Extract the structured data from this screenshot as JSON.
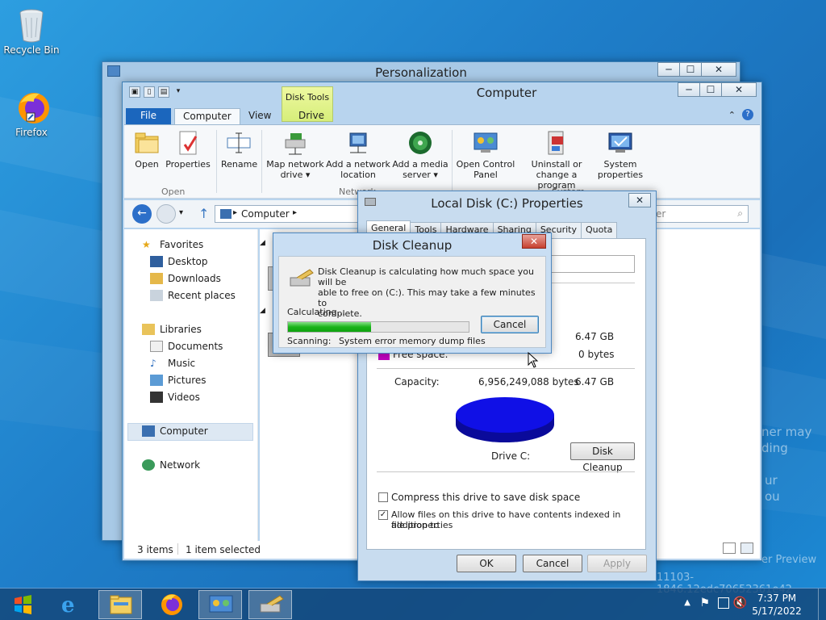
{
  "desktop": {
    "icons": [
      {
        "label": "Recycle Bin",
        "icon": "recycle-bin-icon"
      },
      {
        "label": "Firefox",
        "icon": "firefox-icon"
      }
    ],
    "watermark_lines": [
      "ner may",
      "ding",
      "ur",
      "ou",
      "er Preview",
      "11103-1846.12edc70652361e42"
    ]
  },
  "personalization": {
    "title": "Personalization",
    "caption": {
      "minimize": "─",
      "maximize": "☐",
      "close": "✕"
    }
  },
  "computer": {
    "title": "Computer",
    "context_tab": "Disk Tools",
    "tabs": {
      "file": "File",
      "computer": "Computer",
      "view": "View",
      "drive": "Drive"
    },
    "ribbon": {
      "open": "Open",
      "properties": "Properties",
      "rename": "Rename",
      "map_network_drive_1": "Map network",
      "map_network_drive_2": "drive ▾",
      "add_network_location_1": "Add a network",
      "add_network_location_2": "location",
      "add_media_server_1": "Add a media",
      "add_media_server_2": "server ▾",
      "open_control_panel_1": "Open Control",
      "open_control_panel_2": "Panel",
      "uninstall_1": "Uninstall or",
      "uninstall_2": "change a program",
      "system_properties_1": "System",
      "system_properties_2": "properties",
      "group_open": "Open",
      "group_network": "Network",
      "group_system": "System"
    },
    "address": "Computer",
    "address_arrow": "▸",
    "search_placeholder": "er",
    "nav": {
      "favorites": "Favorites",
      "desktop": "Desktop",
      "downloads": "Downloads",
      "recent_places": "Recent places",
      "libraries": "Libraries",
      "documents": "Documents",
      "music": "Music",
      "pictures": "Pictures",
      "videos": "Videos",
      "computer": "Computer",
      "network": "Network"
    },
    "status": {
      "items": "3 items",
      "selected": "1 item selected"
    }
  },
  "properties": {
    "title": "Local Disk (C:) Properties",
    "tabs": [
      "General",
      "Tools",
      "Hardware",
      "Sharing",
      "Security",
      "Quota"
    ],
    "used_space_gb": "6.47 GB",
    "free_space_label": "Free space:",
    "free_space_bytes": "0 bytes",
    "capacity_label": "Capacity:",
    "capacity_bytes": "6,956,249,088 bytes",
    "capacity_gb": "6.47 GB",
    "drive_label": "Drive C:",
    "disk_cleanup_button": "Disk Cleanup",
    "compress_label": "Compress this drive to save disk space",
    "index_label_1": "Allow files on this drive to have contents indexed in addition to",
    "index_label_2": "file properties",
    "compress_checked": false,
    "index_checked": true,
    "ok": "OK",
    "cancel": "Cancel",
    "apply": "Apply",
    "pie_color": "#1010e6"
  },
  "cleanup": {
    "title": "Disk Cleanup",
    "message_1": "Disk Cleanup is calculating how much space you will be",
    "message_2": "able to free on  (C:). This may take a few minutes to",
    "message_3": "complete.",
    "calculating": "Calculating...",
    "cancel": "Cancel",
    "scanning_label": "Scanning:",
    "scanning_item": "System error memory dump files",
    "progress": 0.46
  },
  "taskbar": {
    "time": "7:37 PM",
    "date": "5/17/2022",
    "tray_arrow": "▲"
  }
}
